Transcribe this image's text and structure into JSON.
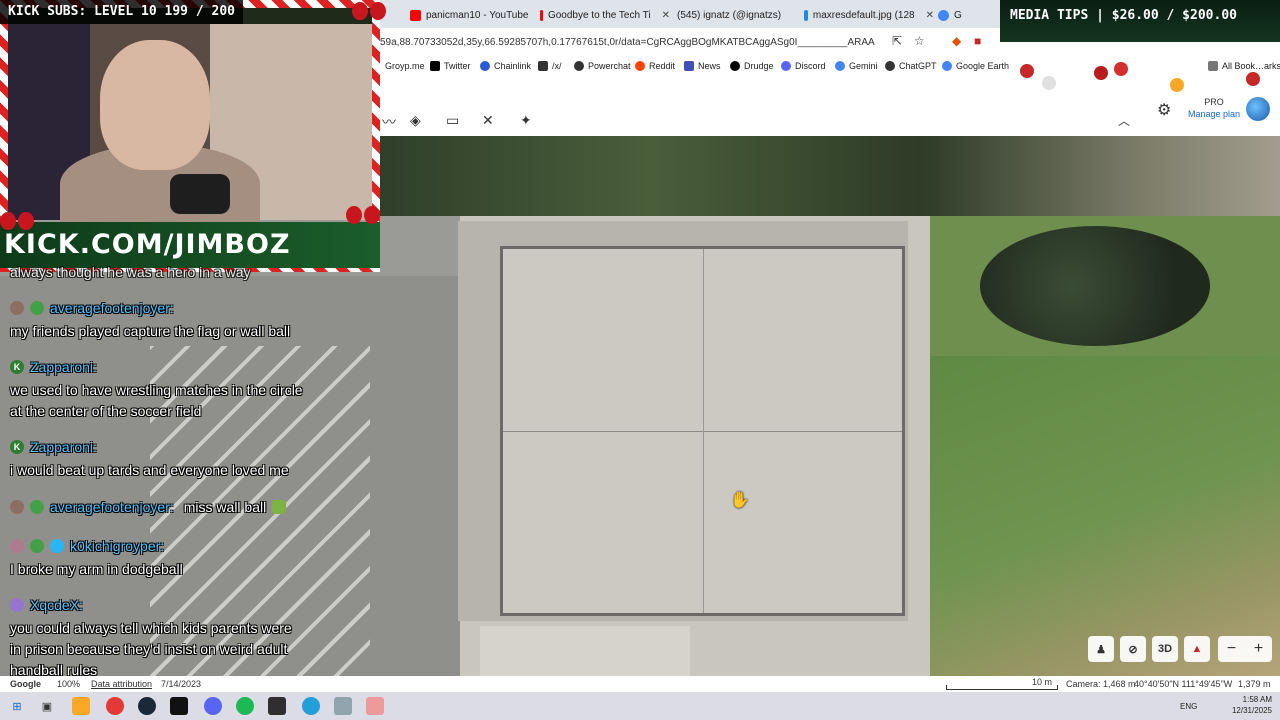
{
  "stream": {
    "kick_subs": "KICK SUBS: LEVEL 10 199 / 200",
    "kick_banner": "KICK.COM/JIMBOZ",
    "media_tips": "MEDIA TIPS | $26.00 / $200.00"
  },
  "browser": {
    "tabs": [
      {
        "label": "panicman10 - YouTube",
        "icon": "youtube-icon",
        "color": "#ff0000"
      },
      {
        "label": "Goodbye to the Tech Ti",
        "icon": "youtube-icon",
        "color": "#ff0000"
      },
      {
        "label": "(545) ignatz (@ignatzs)",
        "icon": "x-icon",
        "color": "#000000"
      },
      {
        "label": "maxresdefault.jpg (128",
        "icon": "image-icon",
        "color": "#1e88e5"
      },
      {
        "label": "G",
        "icon": "earth-icon",
        "color": "#4285f4"
      }
    ],
    "url": "59a,88.70733052d,35y,66.59285707h,0.17767615t,0r/data=CgRCAggBOgMKATBCAggASg0I_________ARAA",
    "bookmarks": [
      {
        "label": "Groyp.me",
        "color": "#8bc34a"
      },
      {
        "label": "Twitter",
        "color": "#000000"
      },
      {
        "label": "Chainlink",
        "color": "#2a5ada"
      },
      {
        "label": "/x/",
        "color": "#333333"
      },
      {
        "label": "Powerchat",
        "color": "#333333"
      },
      {
        "label": "Reddit",
        "color": "#ff4500"
      },
      {
        "label": "News",
        "color": "#3f51b5"
      },
      {
        "label": "Drudge",
        "color": "#000000"
      },
      {
        "label": "Discord",
        "color": "#5865f2"
      },
      {
        "label": "Gemini",
        "color": "#4285f4"
      },
      {
        "label": "ChatGPT",
        "color": "#333333"
      },
      {
        "label": "Google Earth",
        "color": "#4285f4"
      }
    ],
    "all_bookmarks": "All Book…arks"
  },
  "earth": {
    "pro": "PRO",
    "manage_plan": "Manage plan",
    "controls": {
      "three_d": "3D"
    },
    "status": {
      "google": "Google",
      "zoom": "100%",
      "data_attribution": "Data attribution",
      "date": "7/14/2023",
      "scale": "10 m",
      "camera": "Camera: 1,468 m",
      "coords": "40°40'50\"N 111°49'45\"W",
      "elevation": "1,379 m"
    }
  },
  "chat": {
    "partial_top": "always thought he was a hero in a way",
    "messages": [
      {
        "user": "averagefootenjoyer:",
        "text": "my friends played capture the flag or wall ball",
        "badge_color": "#8d6e63"
      },
      {
        "user": "Zapparoni:",
        "text": "we used to have wrestling matches in the circle",
        "text2": "at the center of the soccer field",
        "badge_color": "#2e7d32",
        "badge": "K"
      },
      {
        "user": "Zapparoni:",
        "text": "i would beat up tards and everyone loved me",
        "badge_color": "#2e7d32",
        "badge": "K"
      },
      {
        "user": "averagefootenjoyer:",
        "text": "miss wall ball",
        "badge_color": "#8d6e63"
      },
      {
        "user": "k0kichigroyper:",
        "text": "I broke my arm in dodgeball",
        "badge_color": "#ad7a8e"
      },
      {
        "user": "XqcdeX:",
        "text": "you could always tell which kids parents were",
        "text2": "in prison because they'd insist on weird adult",
        "text3": "handball rules",
        "badge_color": "#9575cd"
      }
    ]
  },
  "taskbar": {
    "lang": "ENG",
    "time": "1:58 AM",
    "date": "12/31/2025"
  }
}
